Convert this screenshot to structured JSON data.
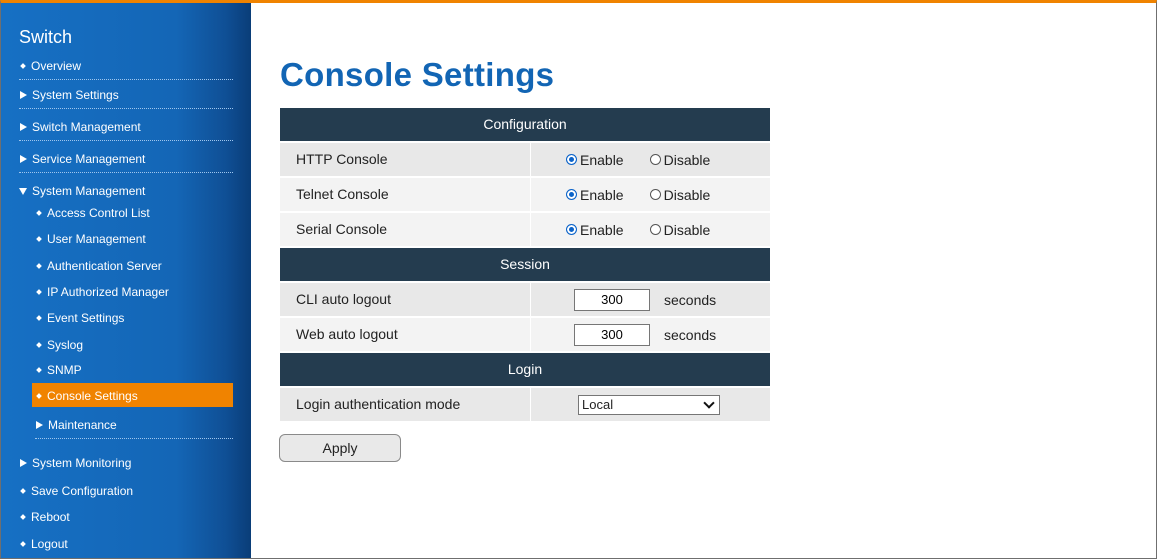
{
  "sidebar": {
    "brand": "Switch",
    "overview": "Overview",
    "system_settings": "System Settings",
    "switch_management": "Switch Management",
    "service_management": "Service Management",
    "system_management": "System Management",
    "sub": {
      "acl": "Access Control List",
      "user_management": "User Management",
      "auth_server": "Authentication Server",
      "ip_authorized": "IP Authorized Manager",
      "event_settings": "Event Settings",
      "syslog": "Syslog",
      "snmp": "SNMP",
      "console_settings": "Console Settings",
      "maintenance": "Maintenance"
    },
    "system_monitoring": "System Monitoring",
    "save_configuration": "Save Configuration",
    "reboot": "Reboot",
    "logout": "Logout"
  },
  "page_title": "Console Settings",
  "configuration": {
    "header": "Configuration",
    "enable_label": "Enable",
    "disable_label": "Disable",
    "rows": [
      {
        "label": "HTTP Console",
        "value": "Enable"
      },
      {
        "label": "Telnet Console",
        "value": "Enable"
      },
      {
        "label": "Serial Console",
        "value": "Enable"
      }
    ]
  },
  "session": {
    "header": "Session",
    "unit": "seconds",
    "cli_label": "CLI auto logout",
    "cli_value": "300",
    "web_label": "Web auto logout",
    "web_value": "300"
  },
  "login": {
    "header": "Login",
    "mode_label": "Login authentication mode",
    "mode_value": "Local"
  },
  "apply_label": "Apply",
  "colors": {
    "accent": "#f08300",
    "title": "#1265b4",
    "header_bg": "#243c4f",
    "sidebar": "#1670c4"
  }
}
